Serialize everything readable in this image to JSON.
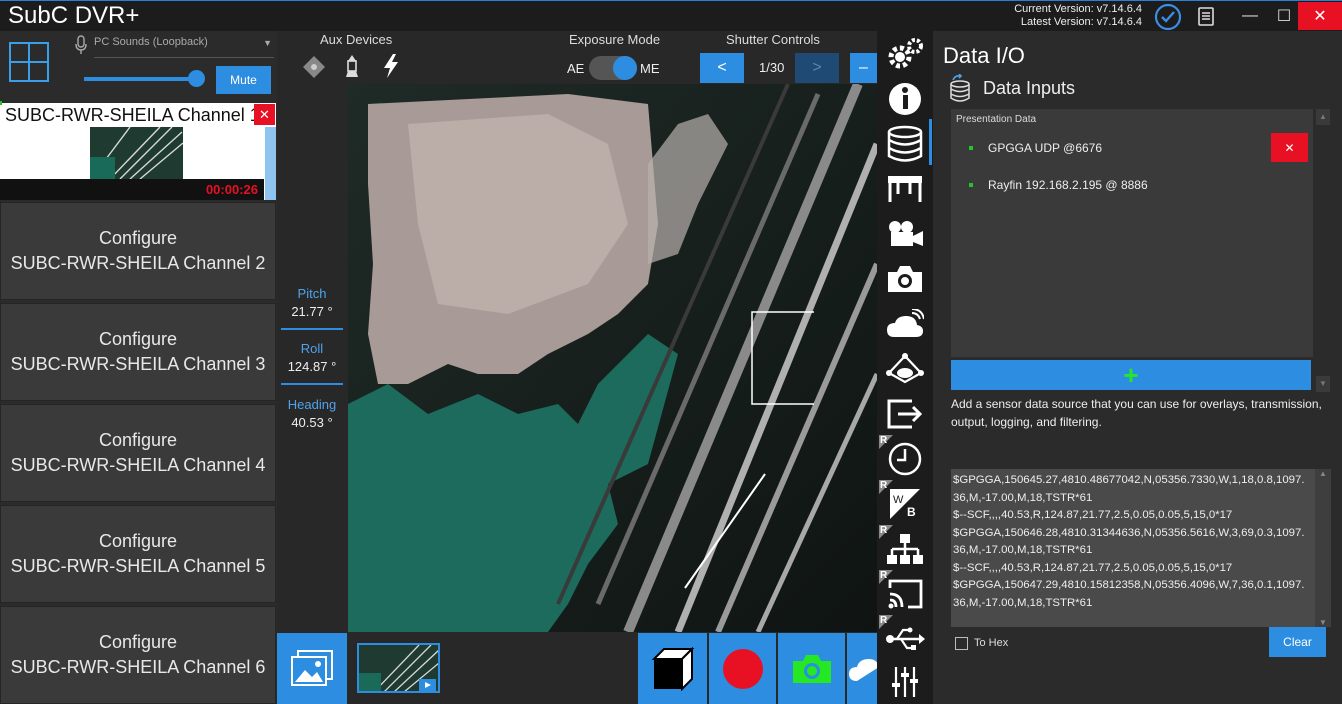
{
  "app": {
    "title": "SubC DVR+"
  },
  "versions": {
    "current": "Current Version: v7.14.6.4",
    "latest": "Latest Version: v7.14.6.4"
  },
  "audio": {
    "device": "PC Sounds (Loopback)",
    "mute_label": "Mute",
    "volume": 0.95
  },
  "aux_devices": {
    "label": "Aux Devices"
  },
  "exposure": {
    "label": "Exposure Mode",
    "left": "AE",
    "right": "ME"
  },
  "shutter": {
    "label": "Shutter Controls",
    "prev": "<",
    "value": "1/30",
    "next": ">",
    "minus": "–"
  },
  "channels": {
    "active": {
      "name": "SUBC-RWR-SHEILA Channel 1",
      "timer": "00:00:26"
    },
    "configure": [
      {
        "line1": "Configure",
        "line2": "SUBC-RWR-SHEILA Channel 2"
      },
      {
        "line1": "Configure",
        "line2": "SUBC-RWR-SHEILA Channel 3"
      },
      {
        "line1": "Configure",
        "line2": "SUBC-RWR-SHEILA Channel 4"
      },
      {
        "line1": "Configure",
        "line2": "SUBC-RWR-SHEILA Channel 5"
      },
      {
        "line1": "Configure",
        "line2": "SUBC-RWR-SHEILA Channel 6"
      }
    ]
  },
  "orientation": {
    "pitch_label": "Pitch",
    "pitch": "21.77 °",
    "roll_label": "Roll",
    "roll": "124.87 °",
    "heading_label": "Heading",
    "heading": "40.53 °"
  },
  "data_io": {
    "title": "Data I/O",
    "inputs_title": "Data Inputs",
    "list_header": "Presentation Data",
    "sources": [
      "GPGGA UDP @6676",
      "Rayfin 192.168.2.195 @ 8886"
    ],
    "add_label": "+",
    "help_text": "Add a sensor data source that you can use for overlays, transmission, output, logging, and filtering.",
    "log_lines": [
      "$GPGGA,150645.27,4810.48677042,N,05356.7330,W,1,18,0.8,1097.",
      "36,M,-17.00,M,18,TSTR*61",
      "$--SCF,,,,40.53,R,124.87,21.77,2.5,0.05,0.05,5,15,0*17",
      "$GPGGA,150646.28,4810.31344636,N,05356.5616,W,3,69,0.3,1097.",
      "36,M,-17.00,M,18,TSTR*61",
      "$--SCF,,,,40.53,R,124.87,21.77,2.5,0.05,0.05,5,15,0*17",
      "$GPGGA,150647.29,4810.15812358,N,05356.4096,W,7,36,0.1,1097.",
      "36,M,-17.00,M,18,TSTR*61"
    ],
    "to_hex_label": "To Hex",
    "clear_label": "Clear"
  },
  "sidebar_icons": [
    "gear-icon",
    "info-icon",
    "database-icon",
    "overlay-icon",
    "video-camera-icon",
    "camera-icon",
    "cloud-icon",
    "network-icon",
    "export-icon",
    "clock-icon",
    "white-balance-icon",
    "lan-icon",
    "cast-icon",
    "usb-icon",
    "sliders-icon"
  ],
  "colors": {
    "accent": "#2d8de0",
    "record": "#e81123",
    "status_green": "#23c423",
    "timer": "#e81123"
  }
}
